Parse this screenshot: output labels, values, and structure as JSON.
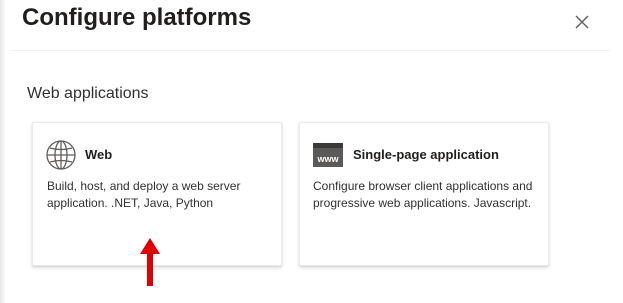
{
  "dialog": {
    "title": "Configure platforms",
    "close_icon": "close-icon"
  },
  "section": {
    "label": "Web applications"
  },
  "cards": [
    {
      "title": "Web",
      "description": "Build, host, and deploy a web server application. .NET, Java, Python",
      "icon": "globe-icon"
    },
    {
      "title": "Single-page application",
      "description": "Configure browser client applications and progressive web applications. Javascript.",
      "icon": "www-window-icon",
      "icon_text": "www"
    }
  ],
  "annotation": {
    "arrow_icon": "up-arrow-icon",
    "arrow_color": "#e00000"
  }
}
